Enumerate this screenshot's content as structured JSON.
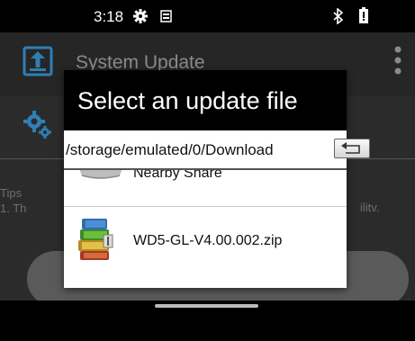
{
  "status_bar": {
    "time": "3:18",
    "icons": [
      "gear-icon",
      "sim-icon",
      "bluetooth-icon",
      "battery-icon"
    ]
  },
  "app": {
    "title": "System Update",
    "tips_title": "Tips",
    "tips_line1": "1. Th",
    "tips_line1_end": "ilitv.",
    "accent_color": "#2f7fb5"
  },
  "dialog": {
    "title": "Select an update file",
    "path": "/storage/emulated/0/Download",
    "items": [
      {
        "label": "Nearby Share",
        "icon": "folder-icon"
      },
      {
        "label": "WD5-GL-V4.00.002.zip",
        "icon": "archive-icon"
      }
    ]
  }
}
